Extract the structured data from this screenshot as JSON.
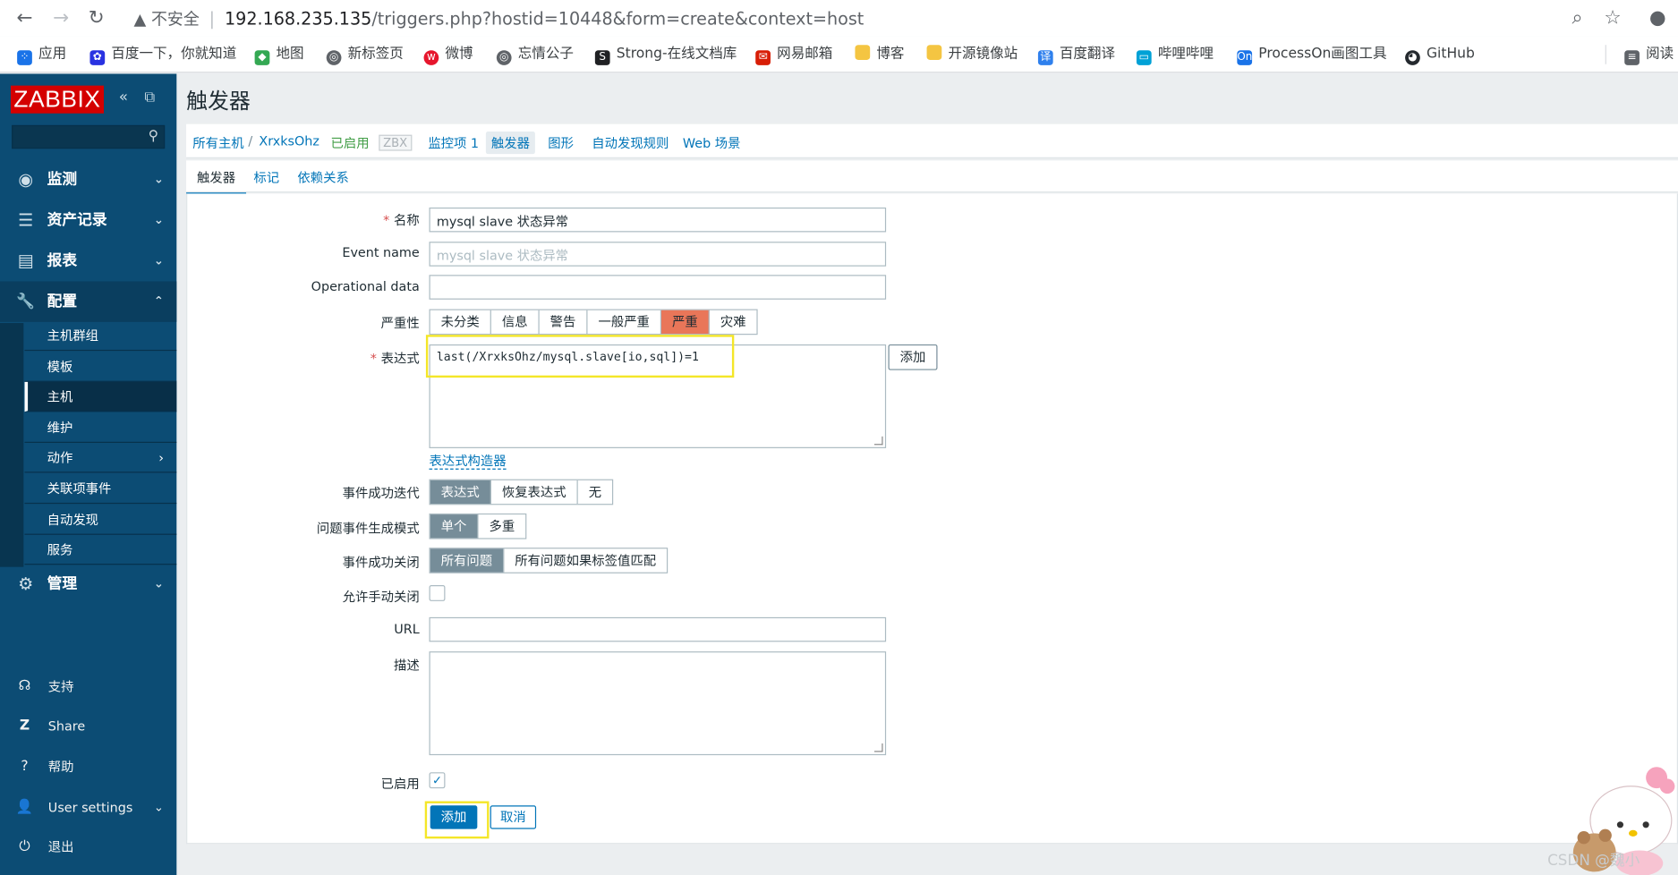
{
  "browser": {
    "back": "←",
    "forward": "→",
    "reload": "↻",
    "security": "▲ 不安全",
    "separator": "|",
    "host": "192.168.235.135",
    "path": "/triggers.php?hostid=10448&form=create&context=host",
    "zoom_icon": "⌕",
    "star_icon": "☆",
    "profile_icon": "●"
  },
  "bookmarks": [
    {
      "label": "应用",
      "icon": "apps-icon",
      "color": "#1a73e8"
    },
    {
      "label": "百度一下，你就知道",
      "icon": "baidu-icon",
      "color": "#2932e1"
    },
    {
      "label": "地图",
      "icon": "maps-icon",
      "color": "#34a853"
    },
    {
      "label": "新标签页",
      "icon": "globe-icon",
      "color": "#5f6368"
    },
    {
      "label": "微博",
      "icon": "weibo-icon",
      "color": "#e6162d"
    },
    {
      "label": "忘情公子",
      "icon": "globe-icon",
      "color": "#5f6368"
    },
    {
      "label": "Strong-在线文档库",
      "icon": "strong-icon",
      "color": "#202124"
    },
    {
      "label": "网易邮箱",
      "icon": "netease-icon",
      "color": "#d81e06"
    },
    {
      "label": "博客",
      "icon": "folder-icon",
      "color": "#f4c542"
    },
    {
      "label": "开源镜像站",
      "icon": "folder-icon",
      "color": "#f4c542"
    },
    {
      "label": "百度翻译",
      "icon": "translate-icon",
      "color": "#2f80ed"
    },
    {
      "label": "哔哩哔哩",
      "icon": "bilibili-icon",
      "color": "#00a1d6"
    },
    {
      "label": "ProcessOn画图工具",
      "icon": "processon-icon",
      "color": "#1a73e8"
    },
    {
      "label": "GitHub",
      "icon": "github-icon",
      "color": "#24292e"
    },
    {
      "label": "阅读",
      "icon": "reading-list-icon",
      "color": "#5f6368"
    }
  ],
  "sidebar": {
    "logo": "ZABBIX",
    "collapse_icon": "«",
    "kiosk_icon": "⧉",
    "search_placeholder": "",
    "search_icon": "⚲",
    "menu": [
      {
        "label": "监测",
        "icon": "◉",
        "arrow": "⌄"
      },
      {
        "label": "资产记录",
        "icon": "☰",
        "arrow": "⌄"
      },
      {
        "label": "报表",
        "icon": "▤",
        "arrow": "⌄"
      },
      {
        "label": "配置",
        "icon": "🔧",
        "arrow": "⌃"
      },
      {
        "label": "管理",
        "icon": "⚙",
        "arrow": "⌄"
      }
    ],
    "submenu": [
      {
        "label": "主机群组"
      },
      {
        "label": "模板"
      },
      {
        "label": "主机"
      },
      {
        "label": "维护"
      },
      {
        "label": "动作",
        "arrow": "›"
      },
      {
        "label": "关联项事件"
      },
      {
        "label": "自动发现"
      },
      {
        "label": "服务"
      }
    ],
    "bottom": [
      {
        "label": "支持",
        "icon": "☊"
      },
      {
        "label": "Share",
        "icon": "Z"
      },
      {
        "label": "帮助",
        "icon": "?"
      },
      {
        "label": "User settings",
        "icon": "👤",
        "arrow": "⌄"
      },
      {
        "label": "退出",
        "icon": "⏻"
      }
    ]
  },
  "page": {
    "title": "触发器",
    "breadcrumb": {
      "all_hosts": "所有主机",
      "sep": "/",
      "host": "XrxksOhz",
      "enabled": "已启用",
      "zbx": "ZBX",
      "items": "监控项 1",
      "triggers": "触发器",
      "graphs": "图形",
      "discovery": "自动发现规则",
      "web": "Web 场景"
    },
    "tabs": [
      "触发器",
      "标记",
      "依赖关系"
    ]
  },
  "form": {
    "name_label": "名称",
    "name_value": "mysql slave 状态异常",
    "event_name_label": "Event name",
    "event_name_placeholder": "mysql slave 状态异常",
    "opdata_label": "Operational data",
    "opdata_value": "",
    "severity_label": "严重性",
    "severity_options": [
      "未分类",
      "信息",
      "警告",
      "一般严重",
      "严重",
      "灾难"
    ],
    "severity_selected": "严重",
    "expression_label": "表达式",
    "expression_value": "last(/XrxksOhz/mysql.slave[io,sql])=1",
    "expression_add": "添加",
    "expression_builder": "表达式构造器",
    "ok_event_label": "事件成功迭代",
    "ok_event_options": [
      "表达式",
      "恢复表达式",
      "无"
    ],
    "ok_event_selected": "表达式",
    "mode_label": "问题事件生成模式",
    "mode_options": [
      "单个",
      "多重"
    ],
    "mode_selected": "单个",
    "close_label": "事件成功关闭",
    "close_options": [
      "所有问题",
      "所有问题如果标签值匹配"
    ],
    "close_selected": "所有问题",
    "manual_close_label": "允许手动关闭",
    "manual_close_checked": false,
    "url_label": "URL",
    "url_value": "",
    "desc_label": "描述",
    "desc_value": "",
    "enabled_label": "已启用",
    "enabled_checked": true,
    "check_mark": "✓",
    "submit": "添加",
    "cancel": "取消"
  },
  "watermark": "CSDN @魏小"
}
